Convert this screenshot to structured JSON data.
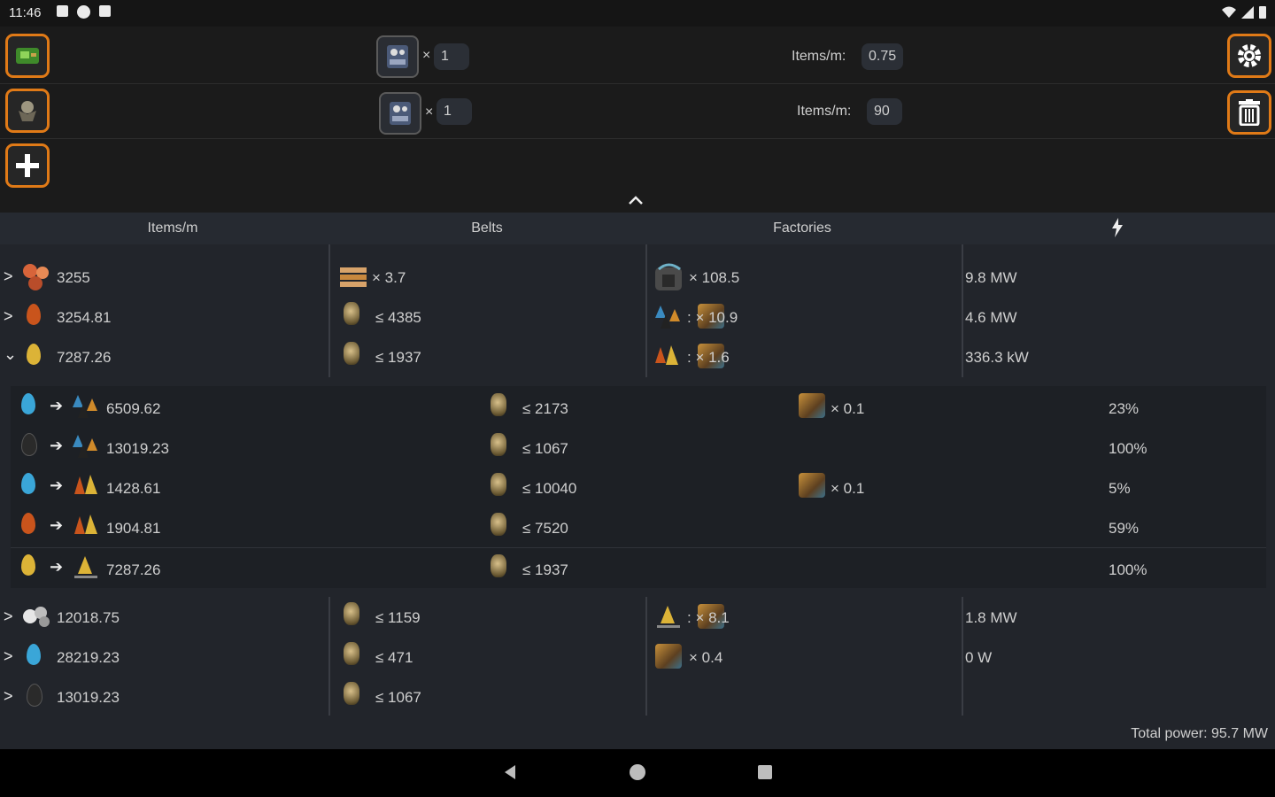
{
  "status_bar": {
    "time": "11:46",
    "icons": [
      "square-notification-icon",
      "p-notification-icon",
      "sd-card-icon"
    ],
    "right_icons": [
      "wifi-icon",
      "signal-icon",
      "battery-icon"
    ]
  },
  "recipes": [
    {
      "product_icon": "green-circuit-icon",
      "factory_icon": "assembler-icon",
      "factory_count": "1",
      "rate_label": "Items/m:",
      "rate_value": "0.75",
      "action_icon": "gear-icon"
    },
    {
      "product_icon": "robot-icon",
      "factory_icon": "assembler-icon",
      "factory_count": "1",
      "rate_label": "Items/m:",
      "rate_value": "90",
      "action_icon": "trash-icon"
    }
  ],
  "add_button_icon": "plus-icon",
  "table": {
    "headers": {
      "items": "Items/m",
      "belts": "Belts",
      "factories": "Factories",
      "power_icon": "lightning-icon"
    },
    "rows": [
      {
        "chev": ">",
        "item_icon": "copper-ore-icon",
        "items": "3255",
        "belts": "× 3.7",
        "factories": "× 108.5",
        "power": "9.8 MW"
      },
      {
        "chev": ">",
        "item_icon": "heavy-oil-icon",
        "items": "3254.81",
        "belts": "≤ 4385",
        "factories": ": × 10.9",
        "power": "4.6 MW"
      },
      {
        "chev": "⌄",
        "item_icon": "light-oil-icon",
        "items": "7287.26",
        "belts": "≤ 1937",
        "factories": ": × 1.6",
        "power": "336.3 kW"
      }
    ],
    "subrows": [
      {
        "item_icon": "water-icon",
        "items": "6509.62",
        "belts": "≤ 2173",
        "factories": "× 0.1",
        "percent": "23%"
      },
      {
        "item_icon": "crude-oil-icon",
        "items": "13019.23",
        "belts": "≤ 1067",
        "factories": "",
        "percent": "100%"
      },
      {
        "item_icon": "water-icon",
        "items": "1428.61",
        "belts": "≤ 10040",
        "factories": "× 0.1",
        "percent": "5%"
      },
      {
        "item_icon": "heavy-oil-icon",
        "items": "1904.81",
        "belts": "≤ 7520",
        "factories": "",
        "percent": "59%"
      },
      {
        "item_icon": "light-oil-icon",
        "items": "7287.26",
        "belts": "≤ 1937",
        "factories": "",
        "percent": "100%"
      }
    ],
    "rows_after": [
      {
        "chev": ">",
        "item_icon": "steam-icon",
        "items": "12018.75",
        "belts": "≤ 1159",
        "factories": ": × 8.1",
        "power": "1.8 MW"
      },
      {
        "chev": ">",
        "item_icon": "water-icon",
        "items": "28219.23",
        "belts": "≤ 471",
        "factories": "× 0.4",
        "power": "0   W"
      },
      {
        "chev": ">",
        "item_icon": "crude-oil-icon",
        "items": "13019.23",
        "belts": "≤ 1067",
        "factories": "",
        "power": ""
      }
    ]
  },
  "total_power": "Total power: 95.7 MW",
  "colors": {
    "accent": "#e07a17",
    "background": "#1b1b1b",
    "table_bg": "#22252b"
  }
}
